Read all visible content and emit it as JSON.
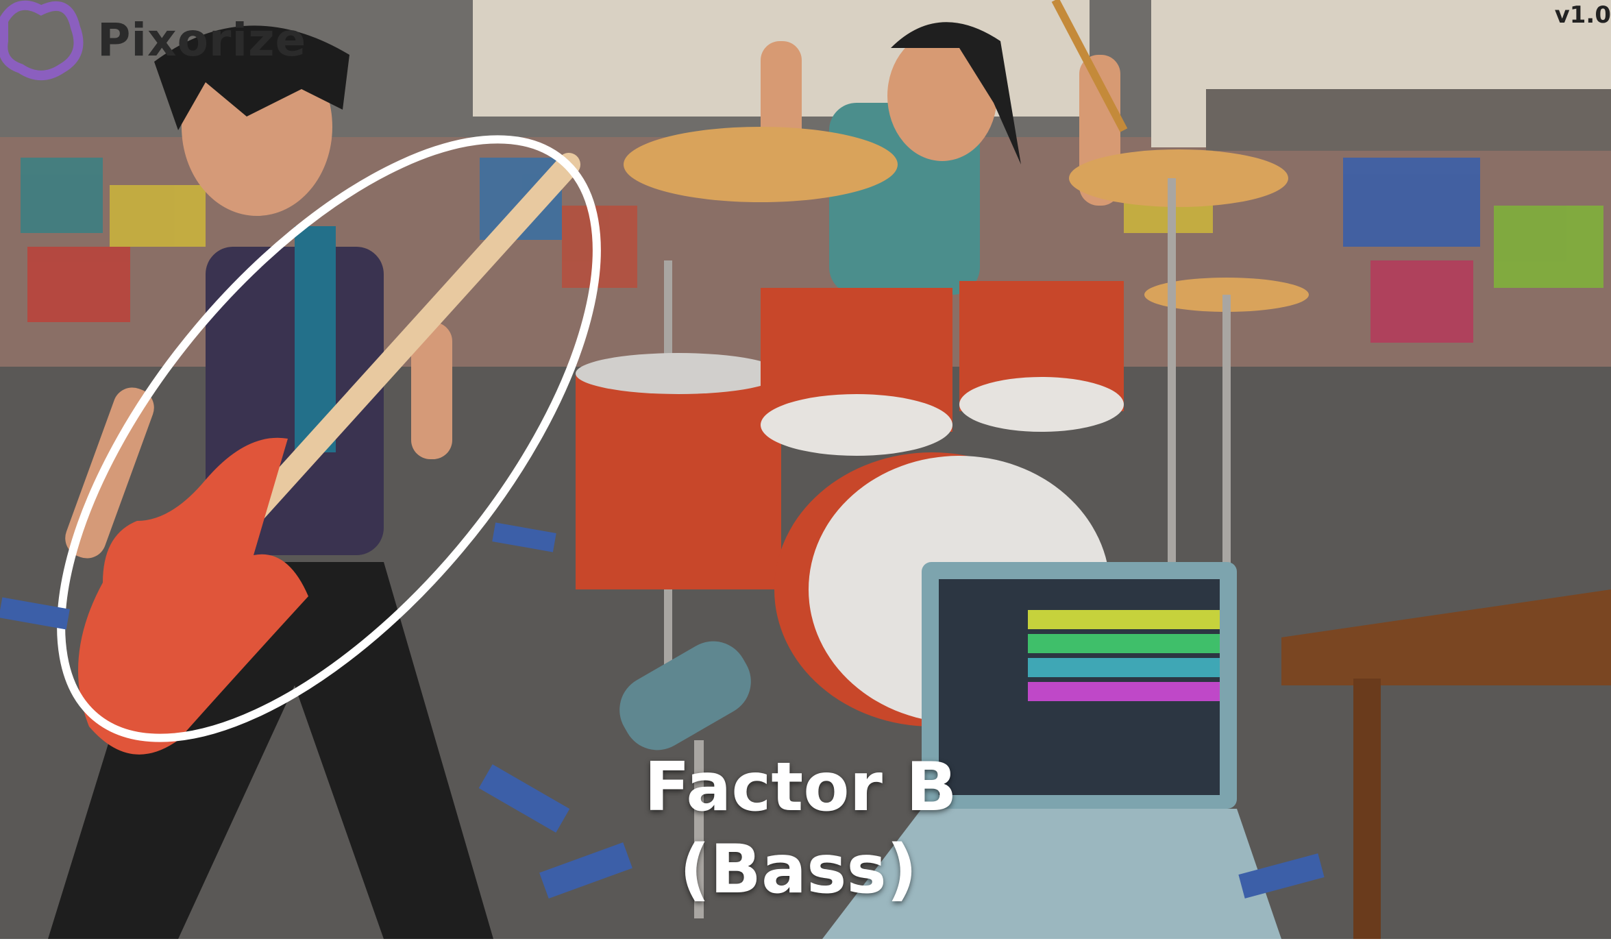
{
  "brand": {
    "name": "Pixorize",
    "logo_icon": "brain-icon"
  },
  "version": "v1.0",
  "caption": {
    "line1": "Factor B",
    "line2": "(Bass)"
  },
  "colors": {
    "wall": "#6f6d6a",
    "floor": "#5a5856",
    "drum_red": "#c8472a",
    "cymbal_gold": "#d9a35b",
    "guitar_red": "#e0553a",
    "laptop_screen": "#93c9d6",
    "highlight_ring": "#ffffff",
    "logo_purple": "#8b5fbf"
  }
}
